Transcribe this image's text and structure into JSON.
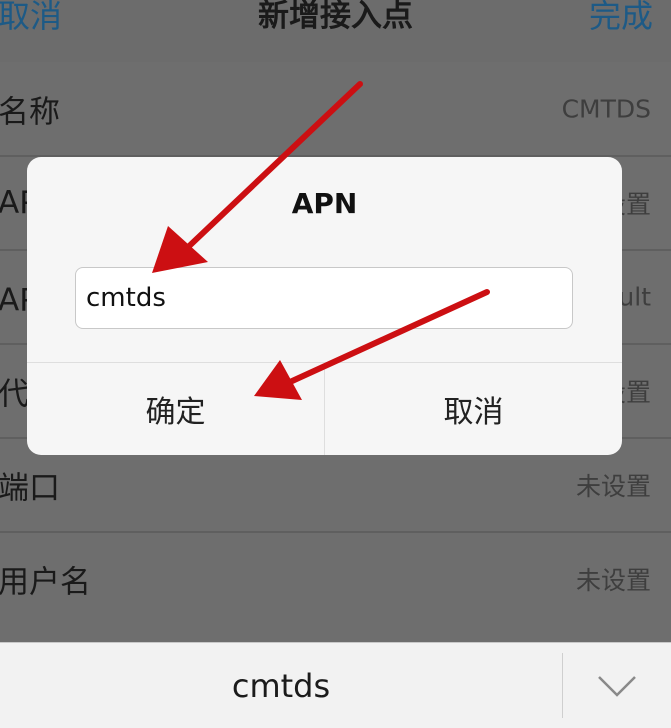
{
  "nav": {
    "cancel_label": "取消",
    "title": "新增接入点",
    "done_label": "完成"
  },
  "rows": [
    {
      "label": "名称",
      "value": "CMTDS"
    },
    {
      "label": "APN",
      "value": "未设置"
    },
    {
      "label": "APN类型",
      "value": "default"
    },
    {
      "label": "代理",
      "value": "未设置"
    },
    {
      "label": "端口",
      "value": "未设置"
    },
    {
      "label": "用户名",
      "value": "未设置"
    }
  ],
  "dialog": {
    "title": "APN",
    "input_value": "cmtds",
    "ok_label": "确定",
    "cancel_label": "取消"
  },
  "keyboard": {
    "suggestion": "cmtds",
    "toggle_icon": "chevron-down-icon"
  },
  "colors": {
    "nav_action": "#1d5a86",
    "arrow": "#cc0f12",
    "dialog_bg": "#f6f6f6"
  }
}
